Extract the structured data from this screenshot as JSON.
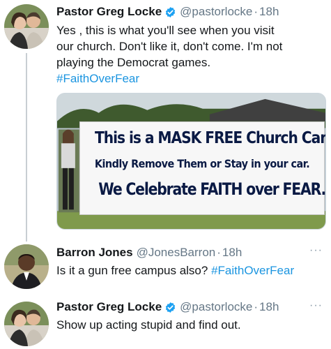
{
  "tweets": [
    {
      "author_name": "Pastor Greg Locke",
      "verified": true,
      "handle": "@pastorlocke",
      "separator": "·",
      "time": "18h",
      "text_lines": [
        "Yes , this is what you'll see when you visit",
        "our church. Don't like it, don't come. I'm not",
        "playing the Democrat games."
      ],
      "hashtag": "#FaithOverFear",
      "image": {
        "sign_line_1": "This is a MASK FREE Church Campus.",
        "sign_line_2": "Kindly Remove Them or Stay in your car.",
        "sign_line_3": "We Celebrate FAITH over FEAR."
      }
    },
    {
      "author_name": "Barron Jones",
      "verified": false,
      "handle": "@JonesBarron",
      "separator": "·",
      "time": "18h",
      "text": "Is it a gun free campus also?",
      "hashtag": "#FaithOverFear"
    },
    {
      "author_name": "Pastor Greg Locke",
      "verified": true,
      "handle": "@pastorlocke",
      "separator": "·",
      "time": "18h",
      "text": "Show up acting stupid and find out."
    }
  ],
  "more_icon": "more-horizontal-icon",
  "colors": {
    "link": "#1b95e0",
    "muted": "#657786",
    "verified": "#1da1f2",
    "thread": "#c8ced3"
  }
}
